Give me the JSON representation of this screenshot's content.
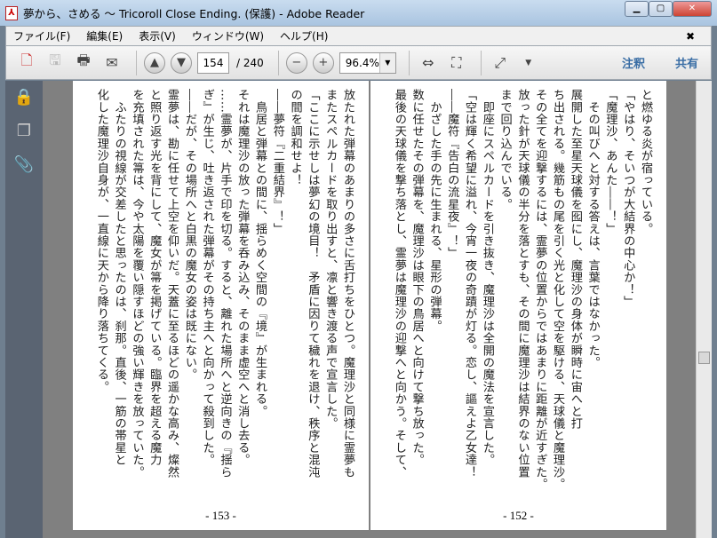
{
  "window": {
    "title": "夢から、さめる ～ Tricoroll Close Ending. (保護) - Adobe Reader"
  },
  "menu": [
    "ファイル(F)",
    "編集(E)",
    "表示(V)",
    "ウィンドウ(W)",
    "ヘルプ(H)"
  ],
  "toolbar": {
    "page_current": "154",
    "page_total": "/ 240",
    "zoom": "96.4%",
    "comment": "注釈",
    "share": "共有"
  },
  "pages": [
    {
      "number": "- 153 -",
      "lines": [
        "放たれた弾幕のあまりの多さに舌打ちをひとつ。魔理沙と同様に霊夢も",
        "またスペルカードを取り出すと、凛と響き渡る声で宣言した。",
        "「ここに示せしは夢幻の境目！　矛盾に因りて穢れを退け、秩序と混沌",
        "の間を調和せよ！",
        "――夢符『二重結界』！」",
        "　鳥居と弾幕との間に、揺らめく空間の『境』が生まれる。",
        "それは魔理沙の放った弾幕を呑み込み、そのまま虚空へと消し去る。",
        "……霊夢が、片手で印を切る。すると、離れた場所へと逆向きの『揺ら",
        "ぎ』が生じ、吐き返された弾幕がその持ち主へと向かって殺到した。",
        "――だが、その場所へと白黒の魔女の姿は既にない。",
        "霊夢は、勘に任せて上空を仰いだ。天蓋に至るほどの遥かな高み、燦然",
        "と照り返す光を背にして、魔女が箒を掲げている。臨界を超える魔力",
        "を充填された箒は、今や太陽を覆い隠すほどの強い輝きを放っていた。",
        "　ふたりの視線が交差したと思ったのは、刹那。直後、一筋の帯星と",
        "化した魔理沙自身が、一直線に天から降り落ちてくる。"
      ]
    },
    {
      "number": "- 152 -",
      "lines": [
        "と燃ゆる炎が宿っている。",
        "「やはり、そいつが大結界の中心か！」",
        "「魔理沙、あんた――！」",
        "　その叫びへと対する答えは、言葉ではなかった。",
        "展開した至星天球儀を囮にし、魔理沙の身体が瞬時に宙へと打",
        "ち出される。幾筋もの尾を引く光と化して空を駆ける、天球儀と魔理沙。",
        "その全てを迎撃するには、霊夢の位置からではあまりに距離が近すぎた。",
        "放った針が天球儀の半分を落とすも、その間に魔理沙は結界のない位置",
        "まで回り込んでいる。",
        "　即座にスペルカードを引き抜き、魔理沙は全開の魔法を宣言した。",
        "「空は輝く希望に溢れ、今宵一夜の奇蹟が灯る。恋し、謳えよ乙女達！",
        "――魔符『告白の流星夜』！」",
        "　かざした手の先に生まれる、星形の弾幕。",
        "数に任せたその弾幕を、魔理沙は眼下の鳥居へと向けて撃ち放った。",
        "最後の天球儀を撃ち落とし、霊夢は魔理沙の迎撃へと向かう。そして、"
      ]
    }
  ]
}
